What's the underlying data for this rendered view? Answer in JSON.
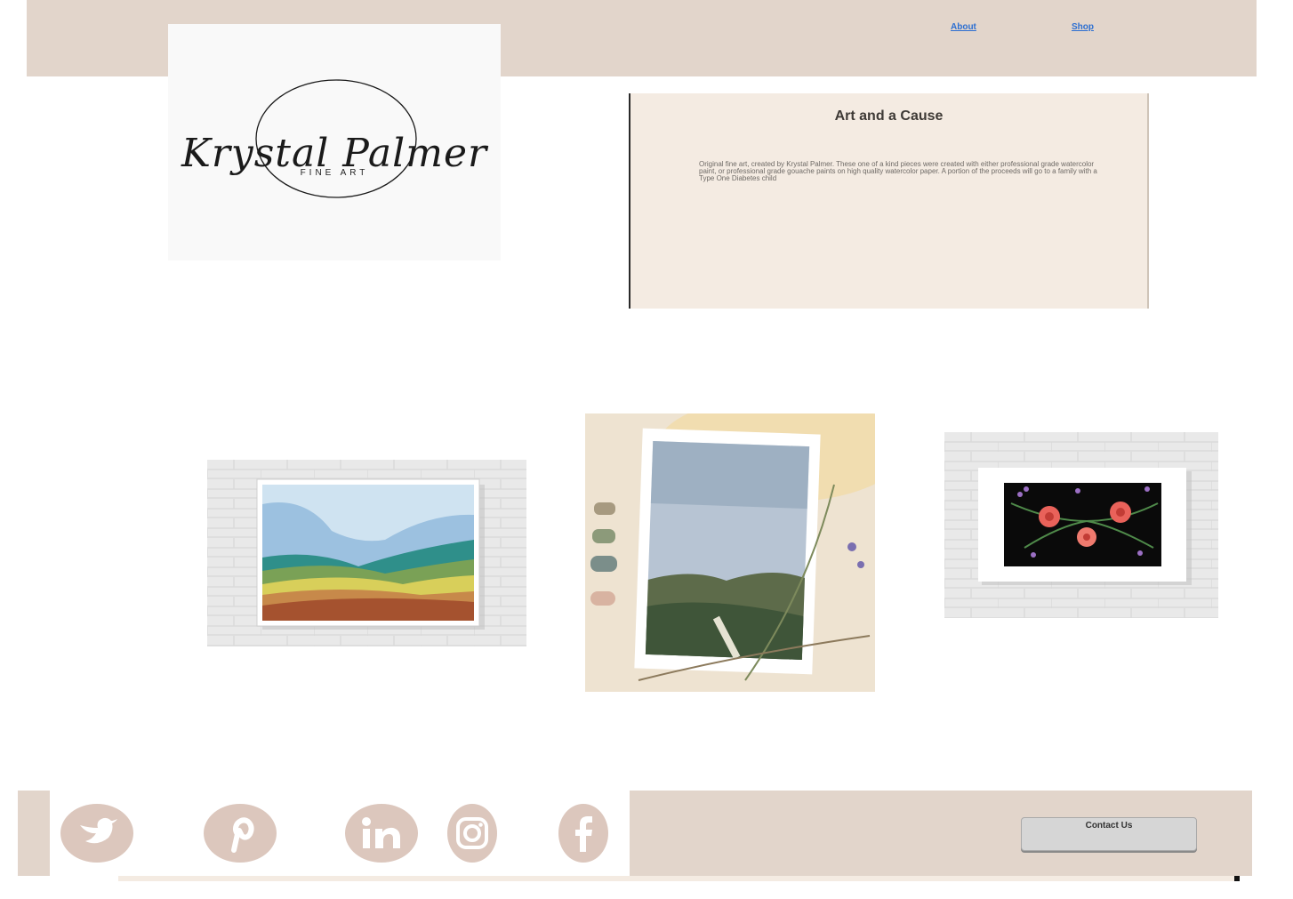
{
  "header": {
    "nav": [
      {
        "label": "About"
      },
      {
        "label": "Shop"
      }
    ]
  },
  "logo": {
    "script_text": "Krystal Palmer",
    "subtitle": "FINE ART"
  },
  "cause": {
    "title": "Art and a Cause",
    "body": "Original fine art, created by Krystal Palmer. These one of a kind pieces were created with either professional grade watercolor paint, or professional grade gouache paints on high quality watercolor paper. A portion of the proceeds will go to a family with a Type One Diabetes child"
  },
  "gallery": {
    "items": [
      {
        "subject": "framed mountain landscape gouache painting"
      },
      {
        "subject": "watercolor sky and hills landscape painting"
      },
      {
        "subject": "framed floral watercolor on black background"
      }
    ]
  },
  "footer": {
    "social": [
      {
        "icon": "twitter-icon"
      },
      {
        "icon": "pinterest-icon"
      },
      {
        "icon": "linkedin-icon"
      },
      {
        "icon": "instagram-icon"
      },
      {
        "icon": "facebook-icon"
      }
    ],
    "contact_label": "Contact Us"
  },
  "colors": {
    "header_bg": "#e2d5cb",
    "panel_bg": "#f4ebe2",
    "link": "#2d6fd1",
    "social_icon_bg": "#dcc7bd"
  }
}
